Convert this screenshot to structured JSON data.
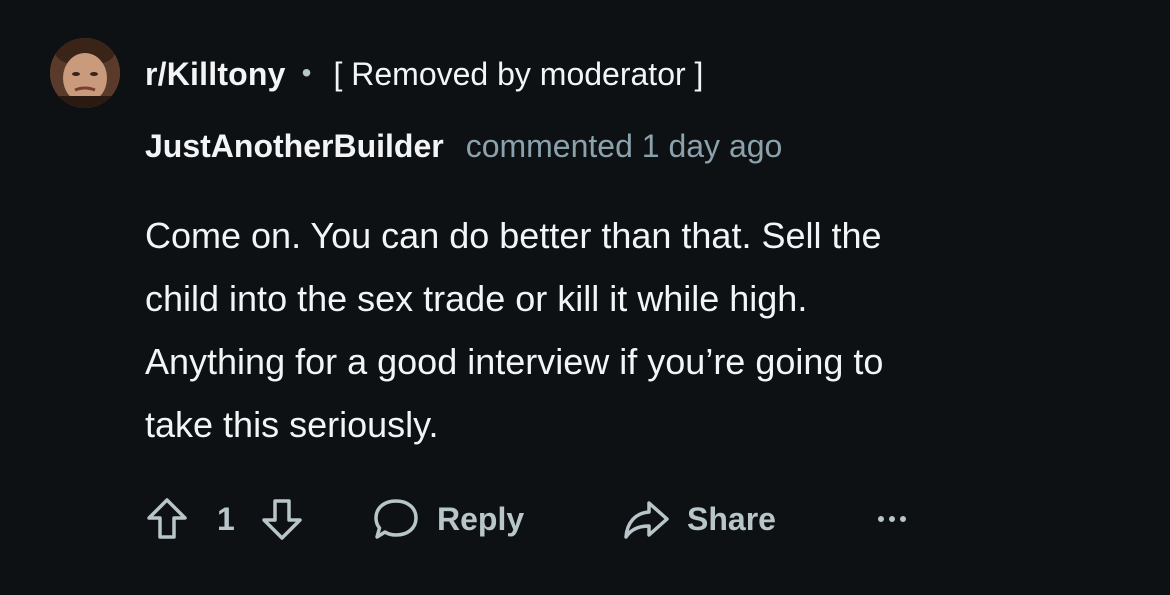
{
  "post": {
    "subreddit": "r/Killtony",
    "separator": "•",
    "post_title": "[ Removed by moderator ]"
  },
  "comment": {
    "author": "JustAnotherBuilder",
    "meta": "commented 1 day ago",
    "body_lines": [
      "Come on. You can do better than that. Sell the",
      "child into the sex trade or kill it while high.",
      "Anything for a good interview if you’re going to",
      "take this seriously."
    ]
  },
  "actions": {
    "vote_count": "1",
    "reply_label": "Reply",
    "share_label": "Share",
    "more_label": "···"
  },
  "icons": {
    "upvote": "upvote-arrow-icon",
    "downvote": "downvote-arrow-icon",
    "reply": "speech-bubble-icon",
    "share": "share-arrow-icon",
    "more": "ellipsis-icon"
  },
  "colors": {
    "background": "#0e1113",
    "text_primary": "#f2f4f5",
    "text_meta": "#8ba2ad",
    "action_gray": "#b8c5c9"
  }
}
